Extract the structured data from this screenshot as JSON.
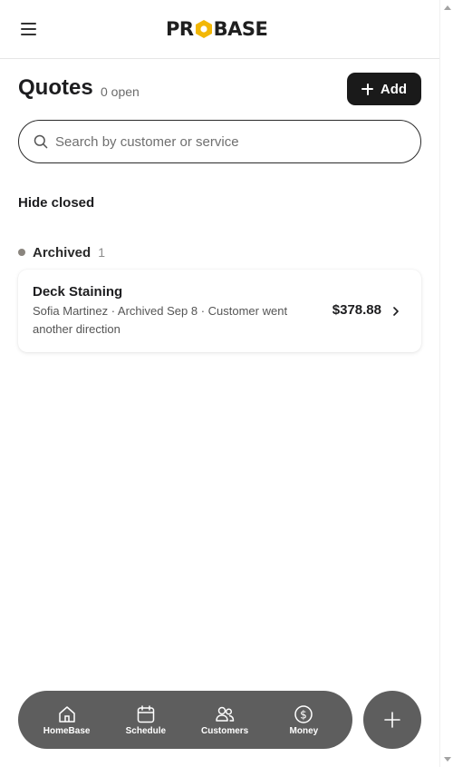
{
  "header": {
    "logo_left": "PR",
    "logo_right": "BASE",
    "logo_color": "#1f1f1f",
    "logo_accent": "#f2b705"
  },
  "page": {
    "title": "Quotes",
    "open_count": "0 open",
    "add_label": "Add"
  },
  "search": {
    "placeholder": "Search by customer or service",
    "value": ""
  },
  "filters": {
    "hide_closed": "Hide closed"
  },
  "groups": [
    {
      "label": "Archived",
      "count": "1",
      "status_color": "#8a857e",
      "items": [
        {
          "title": "Deck Staining",
          "subtitle": "Sofia Martinez · Archived Sep 8 · Customer went another direction",
          "amount": "$378.88"
        }
      ]
    }
  ],
  "nav": {
    "items": [
      {
        "label": "HomeBase",
        "icon": "home-icon"
      },
      {
        "label": "Schedule",
        "icon": "calendar-icon"
      },
      {
        "label": "Customers",
        "icon": "users-icon"
      },
      {
        "label": "Money",
        "icon": "dollar-circle-icon"
      }
    ],
    "fab_icon": "plus-icon",
    "bar_color": "#5e5e5e"
  }
}
